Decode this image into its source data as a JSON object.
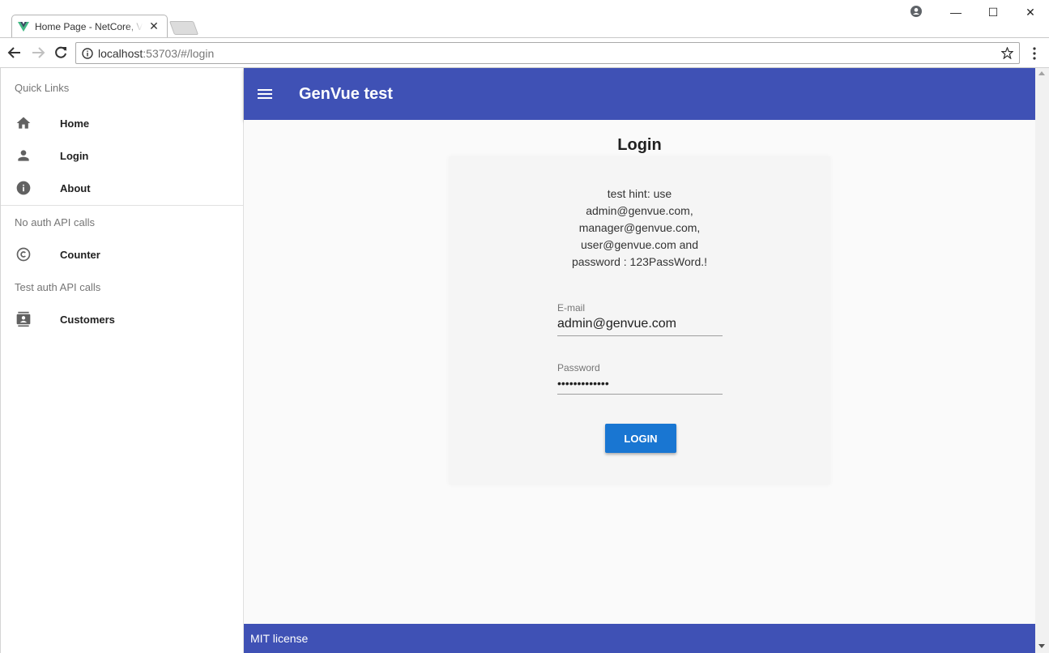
{
  "browser": {
    "tab_title": "Home Page - NetCore, Vue",
    "url_host": "localhost",
    "url_rest": ":53703/#/login",
    "win_minimize": "—",
    "win_maximize": "☐",
    "win_close": "✕",
    "tab_close": "✕"
  },
  "drawer": {
    "sections": [
      {
        "header": "Quick Links",
        "items": [
          {
            "label": "Home",
            "icon": "home-icon"
          },
          {
            "label": "Login",
            "icon": "person-icon"
          },
          {
            "label": "About",
            "icon": "info-icon"
          }
        ]
      },
      {
        "header": "No auth API calls",
        "items": [
          {
            "label": "Counter",
            "icon": "copyright-icon"
          }
        ]
      },
      {
        "header": "Test auth API calls",
        "items": [
          {
            "label": "Customers",
            "icon": "contacts-icon"
          }
        ]
      }
    ]
  },
  "appbar": {
    "title": "GenVue test"
  },
  "login": {
    "title": "Login",
    "hint_lines": [
      "test hint: use",
      "admin@genvue.com,",
      "manager@genvue.com,",
      "user@genvue.com and",
      "password : 123PassWord.!"
    ],
    "email_label": "E-mail",
    "email_value": "admin@genvue.com",
    "password_label": "Password",
    "password_value": "•••••••••••••",
    "button_label": "LOGIN"
  },
  "footer": {
    "text": "MIT license"
  },
  "colors": {
    "primary": "#3f51b5",
    "button": "#1976d2"
  }
}
